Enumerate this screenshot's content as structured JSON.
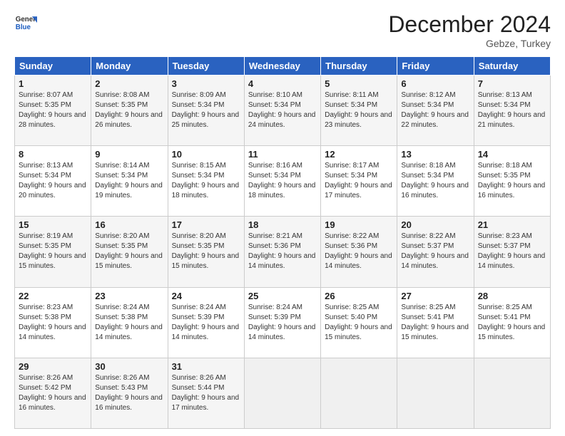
{
  "header": {
    "logo_line1": "General",
    "logo_line2": "Blue",
    "month": "December 2024",
    "location": "Gebze, Turkey"
  },
  "weekdays": [
    "Sunday",
    "Monday",
    "Tuesday",
    "Wednesday",
    "Thursday",
    "Friday",
    "Saturday"
  ],
  "weeks": [
    [
      {
        "day": "1",
        "sunrise": "8:07 AM",
        "sunset": "5:35 PM",
        "daylight": "9 hours and 28 minutes."
      },
      {
        "day": "2",
        "sunrise": "8:08 AM",
        "sunset": "5:35 PM",
        "daylight": "9 hours and 26 minutes."
      },
      {
        "day": "3",
        "sunrise": "8:09 AM",
        "sunset": "5:34 PM",
        "daylight": "9 hours and 25 minutes."
      },
      {
        "day": "4",
        "sunrise": "8:10 AM",
        "sunset": "5:34 PM",
        "daylight": "9 hours and 24 minutes."
      },
      {
        "day": "5",
        "sunrise": "8:11 AM",
        "sunset": "5:34 PM",
        "daylight": "9 hours and 23 minutes."
      },
      {
        "day": "6",
        "sunrise": "8:12 AM",
        "sunset": "5:34 PM",
        "daylight": "9 hours and 22 minutes."
      },
      {
        "day": "7",
        "sunrise": "8:13 AM",
        "sunset": "5:34 PM",
        "daylight": "9 hours and 21 minutes."
      }
    ],
    [
      {
        "day": "8",
        "sunrise": "8:13 AM",
        "sunset": "5:34 PM",
        "daylight": "9 hours and 20 minutes."
      },
      {
        "day": "9",
        "sunrise": "8:14 AM",
        "sunset": "5:34 PM",
        "daylight": "9 hours and 19 minutes."
      },
      {
        "day": "10",
        "sunrise": "8:15 AM",
        "sunset": "5:34 PM",
        "daylight": "9 hours and 18 minutes."
      },
      {
        "day": "11",
        "sunrise": "8:16 AM",
        "sunset": "5:34 PM",
        "daylight": "9 hours and 18 minutes."
      },
      {
        "day": "12",
        "sunrise": "8:17 AM",
        "sunset": "5:34 PM",
        "daylight": "9 hours and 17 minutes."
      },
      {
        "day": "13",
        "sunrise": "8:18 AM",
        "sunset": "5:34 PM",
        "daylight": "9 hours and 16 minutes."
      },
      {
        "day": "14",
        "sunrise": "8:18 AM",
        "sunset": "5:35 PM",
        "daylight": "9 hours and 16 minutes."
      }
    ],
    [
      {
        "day": "15",
        "sunrise": "8:19 AM",
        "sunset": "5:35 PM",
        "daylight": "9 hours and 15 minutes."
      },
      {
        "day": "16",
        "sunrise": "8:20 AM",
        "sunset": "5:35 PM",
        "daylight": "9 hours and 15 minutes."
      },
      {
        "day": "17",
        "sunrise": "8:20 AM",
        "sunset": "5:35 PM",
        "daylight": "9 hours and 15 minutes."
      },
      {
        "day": "18",
        "sunrise": "8:21 AM",
        "sunset": "5:36 PM",
        "daylight": "9 hours and 14 minutes."
      },
      {
        "day": "19",
        "sunrise": "8:22 AM",
        "sunset": "5:36 PM",
        "daylight": "9 hours and 14 minutes."
      },
      {
        "day": "20",
        "sunrise": "8:22 AM",
        "sunset": "5:37 PM",
        "daylight": "9 hours and 14 minutes."
      },
      {
        "day": "21",
        "sunrise": "8:23 AM",
        "sunset": "5:37 PM",
        "daylight": "9 hours and 14 minutes."
      }
    ],
    [
      {
        "day": "22",
        "sunrise": "8:23 AM",
        "sunset": "5:38 PM",
        "daylight": "9 hours and 14 minutes."
      },
      {
        "day": "23",
        "sunrise": "8:24 AM",
        "sunset": "5:38 PM",
        "daylight": "9 hours and 14 minutes."
      },
      {
        "day": "24",
        "sunrise": "8:24 AM",
        "sunset": "5:39 PM",
        "daylight": "9 hours and 14 minutes."
      },
      {
        "day": "25",
        "sunrise": "8:24 AM",
        "sunset": "5:39 PM",
        "daylight": "9 hours and 14 minutes."
      },
      {
        "day": "26",
        "sunrise": "8:25 AM",
        "sunset": "5:40 PM",
        "daylight": "9 hours and 15 minutes."
      },
      {
        "day": "27",
        "sunrise": "8:25 AM",
        "sunset": "5:41 PM",
        "daylight": "9 hours and 15 minutes."
      },
      {
        "day": "28",
        "sunrise": "8:25 AM",
        "sunset": "5:41 PM",
        "daylight": "9 hours and 15 minutes."
      }
    ],
    [
      {
        "day": "29",
        "sunrise": "8:26 AM",
        "sunset": "5:42 PM",
        "daylight": "9 hours and 16 minutes."
      },
      {
        "day": "30",
        "sunrise": "8:26 AM",
        "sunset": "5:43 PM",
        "daylight": "9 hours and 16 minutes."
      },
      {
        "day": "31",
        "sunrise": "8:26 AM",
        "sunset": "5:44 PM",
        "daylight": "9 hours and 17 minutes."
      },
      null,
      null,
      null,
      null
    ]
  ],
  "labels": {
    "sunrise": "Sunrise:",
    "sunset": "Sunset:",
    "daylight": "Daylight:"
  }
}
